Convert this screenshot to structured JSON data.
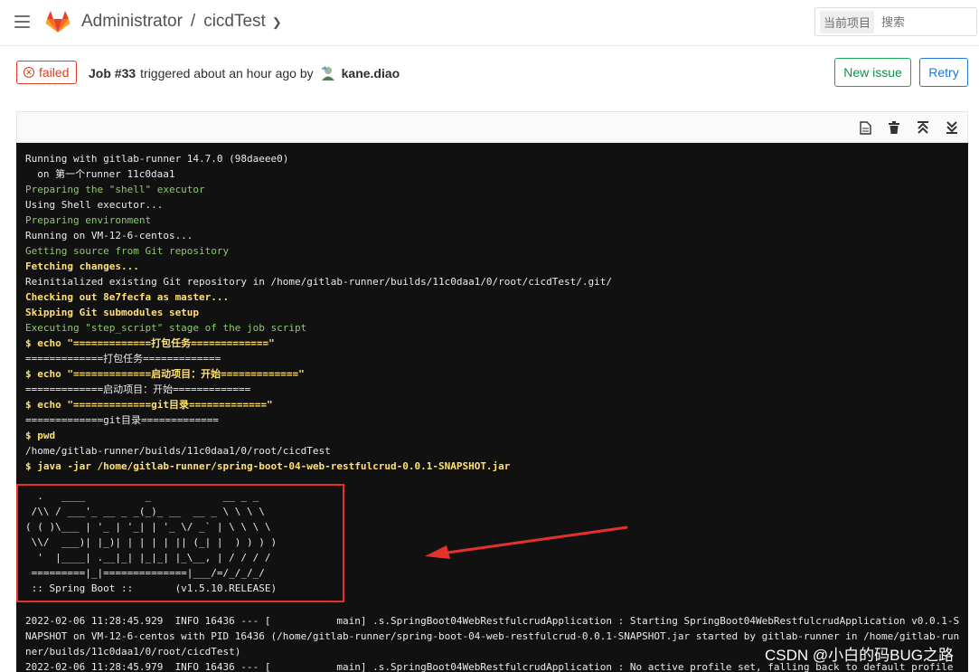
{
  "nav": {
    "breadcrumb_owner": "Administrator",
    "breadcrumb_project": "cicdTest",
    "search_scope": "当前项目",
    "search_placeholder": "搜索"
  },
  "job": {
    "status": "failed",
    "title": "Job #33",
    "triggered_text": "triggered about an hour ago by",
    "user": "kane.diao",
    "new_issue_label": "New issue",
    "retry_label": "Retry"
  },
  "log_tools": [
    "raw-log-icon",
    "erase-icon",
    "scroll-top-icon",
    "scroll-bottom-icon"
  ],
  "log": {
    "lines": [
      {
        "text": "Running with gitlab-runner 14.7.0 (98daeee0)",
        "style": ""
      },
      {
        "text": "  on 第一个runner 11c0daa1",
        "style": ""
      },
      {
        "text": "Preparing the \"shell\" executor",
        "style": "g"
      },
      {
        "text": "Using Shell executor...",
        "style": ""
      },
      {
        "text": "Preparing environment",
        "style": "g"
      },
      {
        "text": "Running on VM-12-6-centos...",
        "style": ""
      },
      {
        "text": "Getting source from Git repository",
        "style": "g"
      },
      {
        "text": "Fetching changes...",
        "style": "y"
      },
      {
        "text": "Reinitialized existing Git repository in /home/gitlab-runner/builds/11c0daa1/0/root/cicdTest/.git/",
        "style": ""
      },
      {
        "text": "Checking out 8e7fecfa as master...",
        "style": "y"
      },
      {
        "text": "Skipping Git submodules setup",
        "style": "y"
      },
      {
        "text": "Executing \"step_script\" stage of the job script",
        "style": "g"
      },
      {
        "text": "$ echo \"=============打包任务=============\"",
        "style": "y"
      },
      {
        "text": "=============打包任务=============",
        "style": ""
      },
      {
        "text": "$ echo \"=============启动项目：开始=============\"",
        "style": "y"
      },
      {
        "text": "=============启动项目：开始=============",
        "style": ""
      },
      {
        "text": "$ echo \"=============git目录=============\"",
        "style": "y"
      },
      {
        "text": "=============git目录=============",
        "style": ""
      },
      {
        "text": "$ pwd",
        "style": "y"
      },
      {
        "text": "/home/gitlab-runner/builds/11c0daa1/0/root/cicdTest",
        "style": ""
      },
      {
        "text": "$ java -jar /home/gitlab-runner/spring-boot-04-web-restfulcrud-0.0.1-SNAPSHOT.jar",
        "style": "y"
      }
    ],
    "banner": [
      "  .   ____          _            __ _ _",
      " /\\\\ / ___'_ __ _ _(_)_ __  __ _ \\ \\ \\ \\",
      "( ( )\\___ | '_ | '_| | '_ \\/ _` | \\ \\ \\ \\",
      " \\\\/  ___)| |_)| | | | | || (_| |  ) ) ) )",
      "  '  |____| .__|_| |_|_| |_\\__, | / / / /",
      " =========|_|==============|___/=/_/_/_/",
      " :: Spring Boot ::       (v1.5.10.RELEASE)"
    ],
    "tail": [
      "2022-02-06 11:28:45.929  INFO 16436 --- [           main] .s.SpringBoot04WebRestfulcrudApplication : Starting SpringBoot04WebRestfulcrudApplication v0.0.1-S",
      "NAPSHOT on VM-12-6-centos with PID 16436 (/home/gitlab-runner/spring-boot-04-web-restfulcrud-0.0.1-SNAPSHOT.jar started by gitlab-runner in /home/gitlab-run",
      "ner/builds/11c0daa1/0/root/cicdTest)",
      "2022-02-06 11:28:45.979  INFO 16436 --- [           main] .s.SpringBoot04WebRestfulcrudApplication : No active profile set, falling back to default profile"
    ]
  },
  "watermark": "CSDN @小白的码BUG之路",
  "colors": {
    "failed": "#db3b21",
    "green": "#8cc96d",
    "yellow": "#ffe071",
    "highlight": "#e5312b"
  }
}
